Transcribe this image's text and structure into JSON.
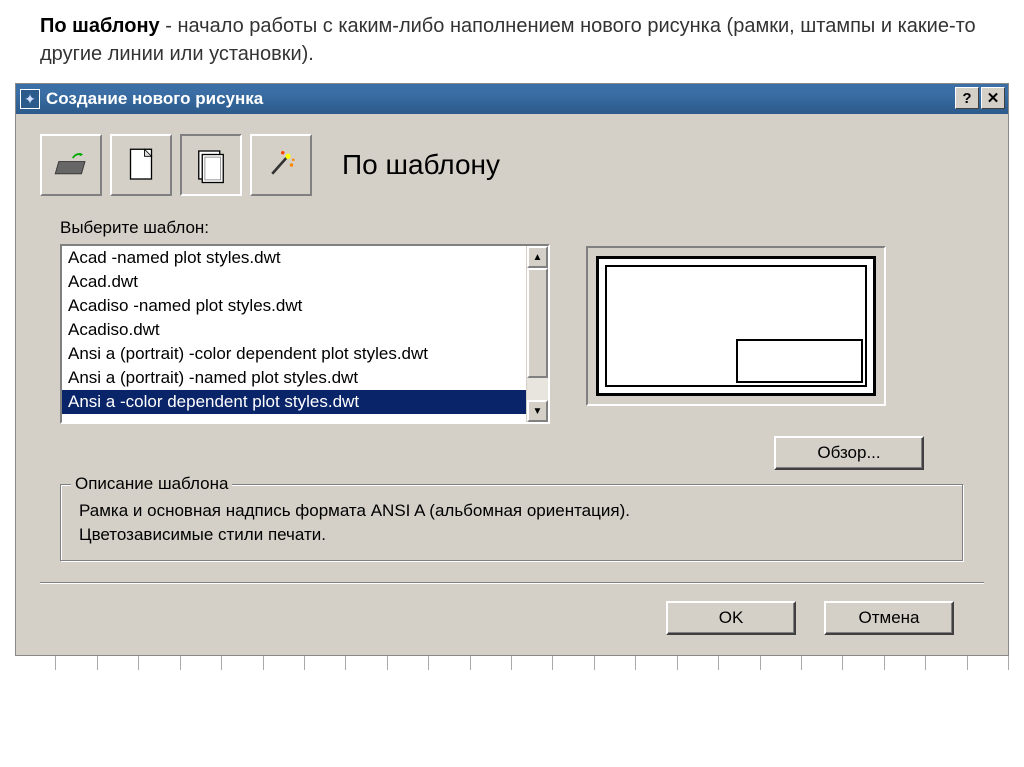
{
  "doc": {
    "bold": "По шаблону",
    "rest": " - начало работы с каким-либо наполнением нового рисунка (рамки, штампы и какие-то другие линии или установки)."
  },
  "titlebar": {
    "title": "Создание нового рисунка",
    "help": "?",
    "close": "✕"
  },
  "mode_title": "По шаблону",
  "list_label": "Выберите шаблон:",
  "templates": {
    "items": [
      "Acad -named plot styles.dwt",
      "Acad.dwt",
      "Acadiso -named plot styles.dwt",
      "Acadiso.dwt",
      "Ansi a (portrait) -color dependent plot styles.dwt",
      "Ansi a (portrait) -named plot styles.dwt",
      "Ansi a -color dependent plot styles.dwt"
    ],
    "selected_index": 6
  },
  "browse_label": "Обзор...",
  "description": {
    "group_label": "Описание шаблона",
    "line1": "Рамка и основная надпись формата ANSI A (альбомная ориентация).",
    "line2": "Цветозависимые стили печати."
  },
  "buttons": {
    "ok": "OK",
    "cancel": "Отмена"
  },
  "scroll": {
    "up": "▲",
    "down": "▼"
  }
}
